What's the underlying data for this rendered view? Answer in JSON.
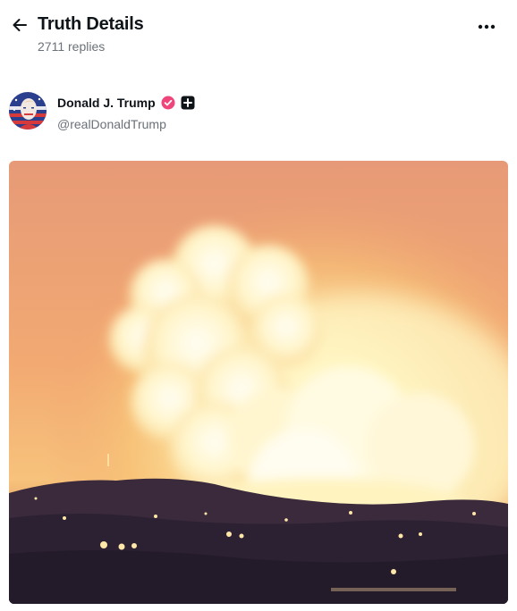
{
  "header": {
    "title": "Truth Details",
    "replies": "2711 replies"
  },
  "author": {
    "name": "Donald J. Trump",
    "handle": "@realDonaldTrump"
  },
  "icons": {
    "back": "arrow-left-icon",
    "more": "more-horizontal-icon",
    "verified": "verified-badge-icon",
    "plus": "plus-badge-icon"
  },
  "colors": {
    "verified_badge": "#f0457a",
    "muted_text": "#6b7178"
  }
}
